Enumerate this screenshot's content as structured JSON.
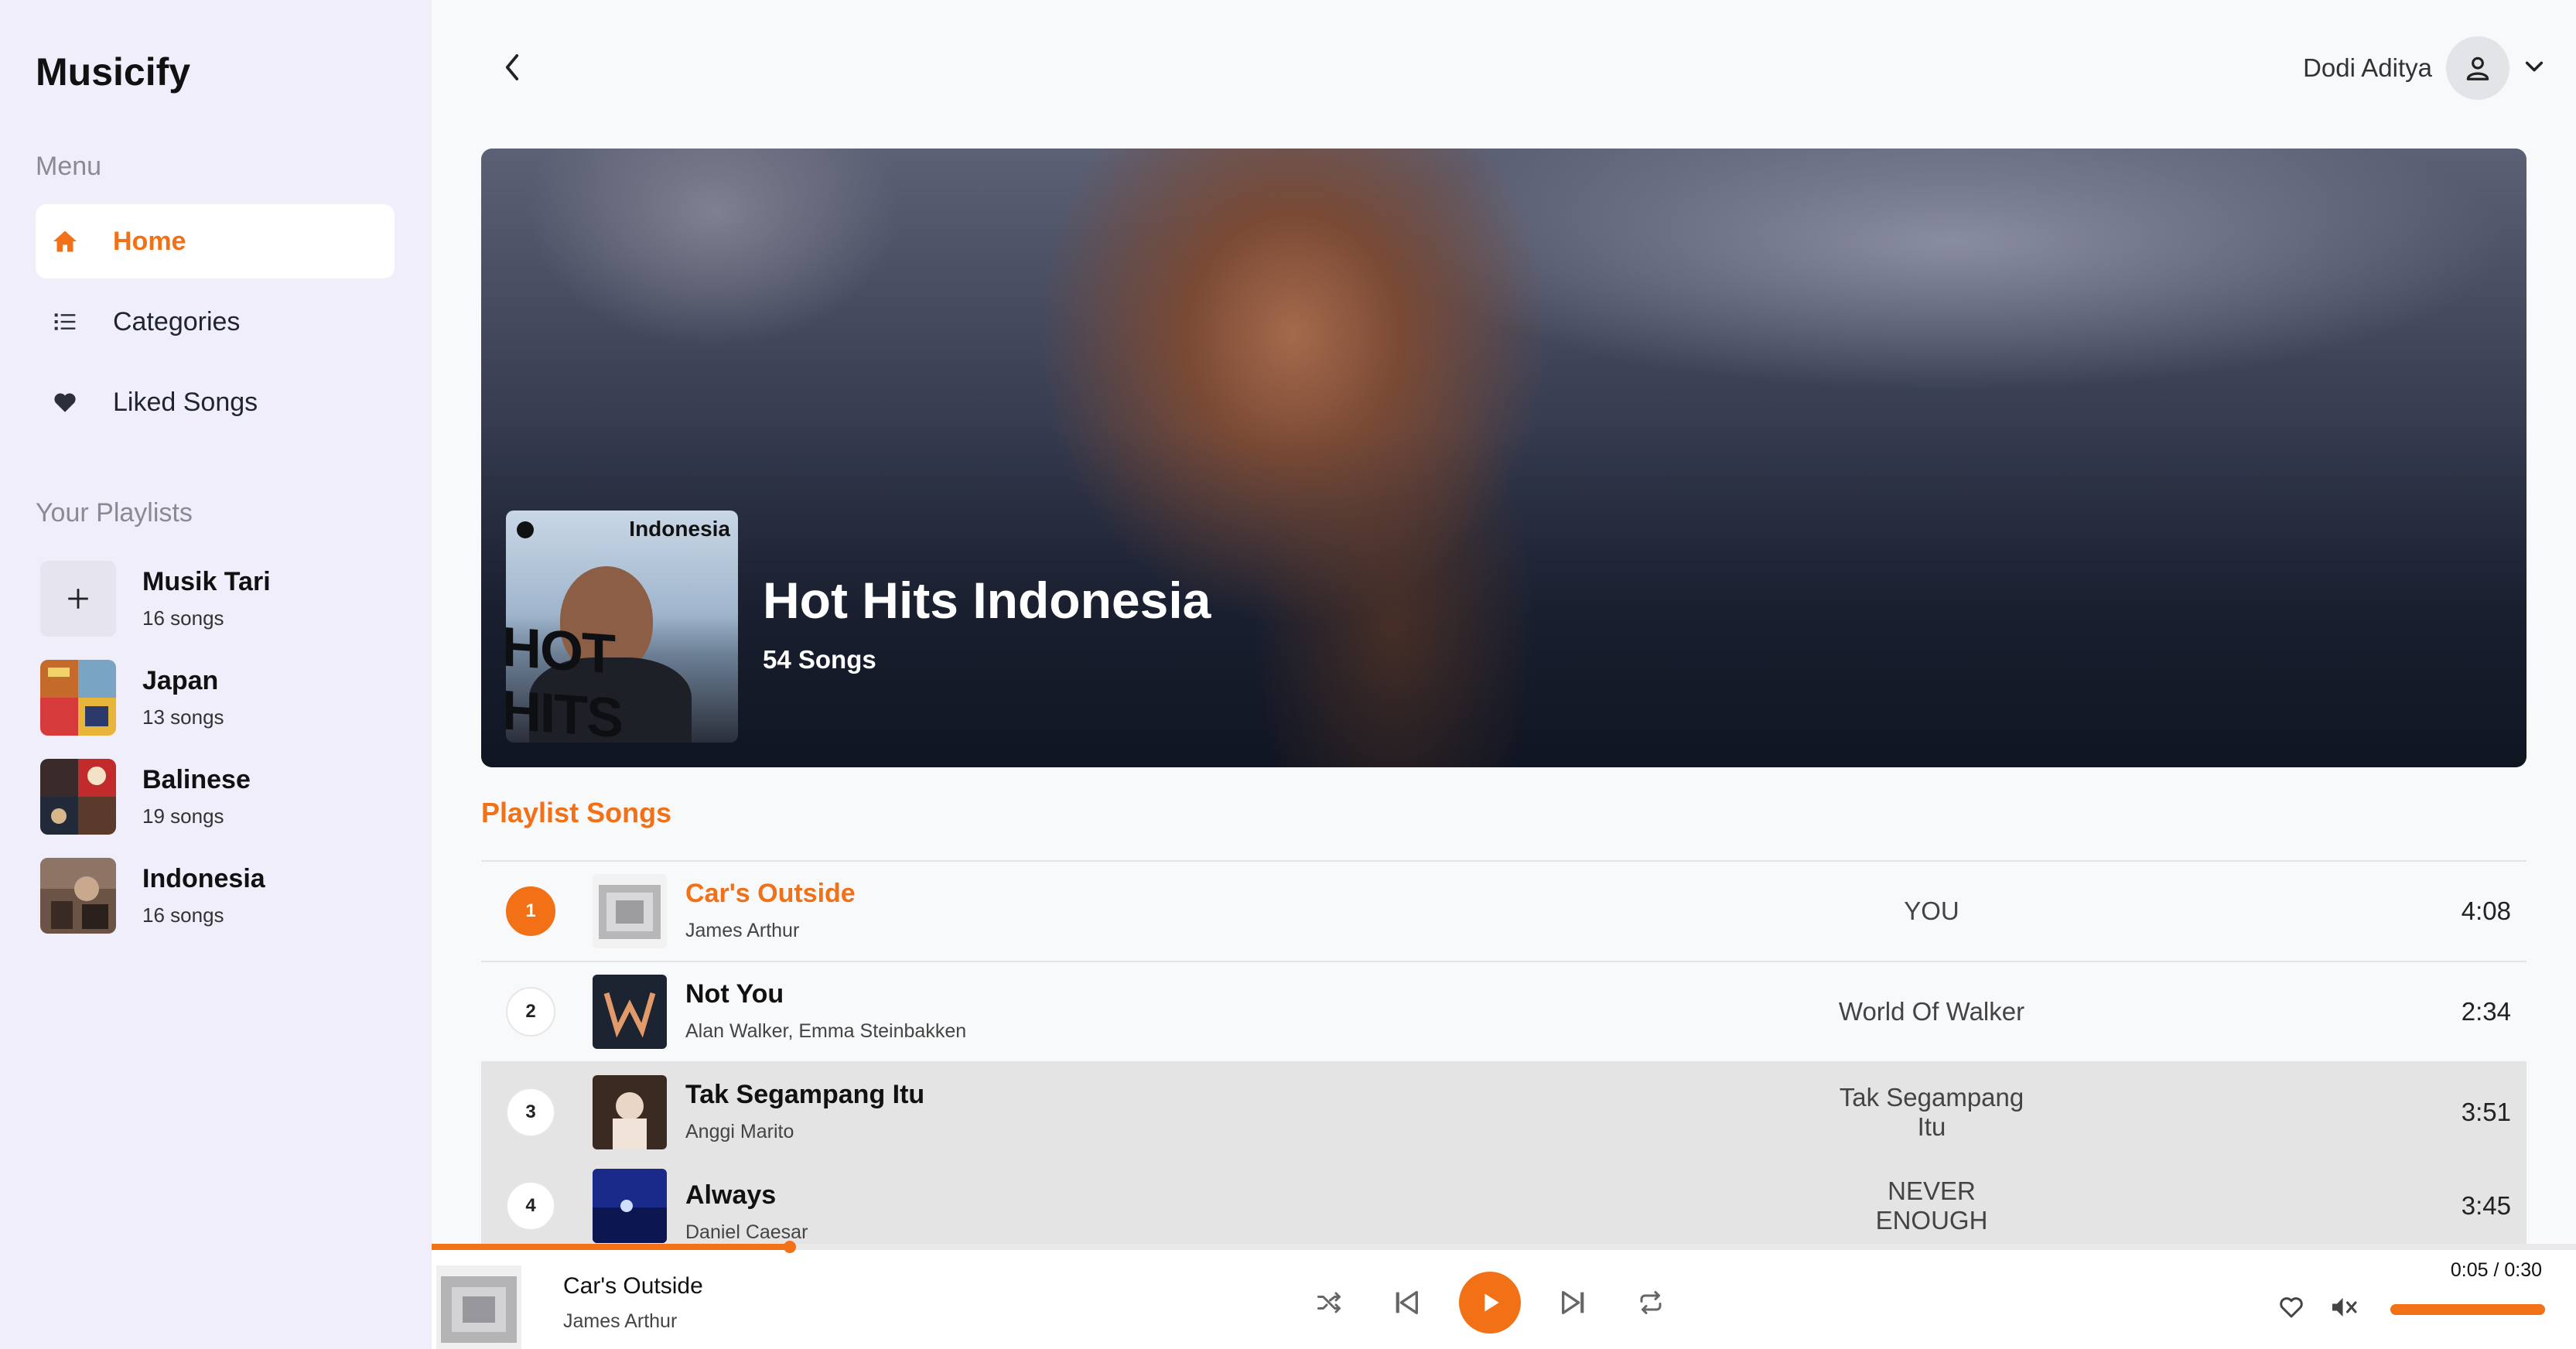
{
  "brand": "Musicify",
  "sidebar": {
    "menu_label": "Menu",
    "menu": [
      {
        "label": "Home",
        "icon": "home-icon",
        "active": true
      },
      {
        "label": "Categories",
        "icon": "list-icon",
        "active": false
      },
      {
        "label": "Liked Songs",
        "icon": "heart-icon",
        "active": false
      }
    ],
    "playlists_label": "Your Playlists",
    "playlists": [
      {
        "name": "Musik Tari",
        "count": "16 songs",
        "icon": "plus-icon"
      },
      {
        "name": "Japan",
        "count": "13 songs"
      },
      {
        "name": "Balinese",
        "count": "19 songs"
      },
      {
        "name": "Indonesia",
        "count": "16 songs"
      }
    ]
  },
  "header": {
    "user_name": "Dodi Aditya"
  },
  "hero": {
    "cover_label": "Indonesia",
    "cover_text": "HOT HITS",
    "title": "Hot Hits Indonesia",
    "subtitle": "54 Songs"
  },
  "songs_section": {
    "title": "Playlist Songs",
    "songs": [
      {
        "num": "1",
        "title": "Car's Outside",
        "artist": "James Arthur",
        "album": "YOU",
        "duration": "4:08",
        "active": true
      },
      {
        "num": "2",
        "title": "Not You",
        "artist": "Alan Walker, Emma Steinbakken",
        "album": "World Of Walker",
        "duration": "2:34"
      },
      {
        "num": "3",
        "title": "Tak Segampang Itu",
        "artist": "Anggi Marito",
        "album": "Tak Segampang Itu",
        "duration": "3:51"
      },
      {
        "num": "4",
        "title": "Always",
        "artist": "Daniel Caesar",
        "album": "NEVER ENOUGH",
        "duration": "3:45"
      }
    ]
  },
  "player": {
    "title": "Car's Outside",
    "artist": "James Arthur",
    "time": "0:05 / 0:30",
    "progress": 0.167,
    "volume": 1.0,
    "muted": true
  },
  "colors": {
    "accent": "#f27016",
    "sidebar_bg": "#f1eefc"
  }
}
